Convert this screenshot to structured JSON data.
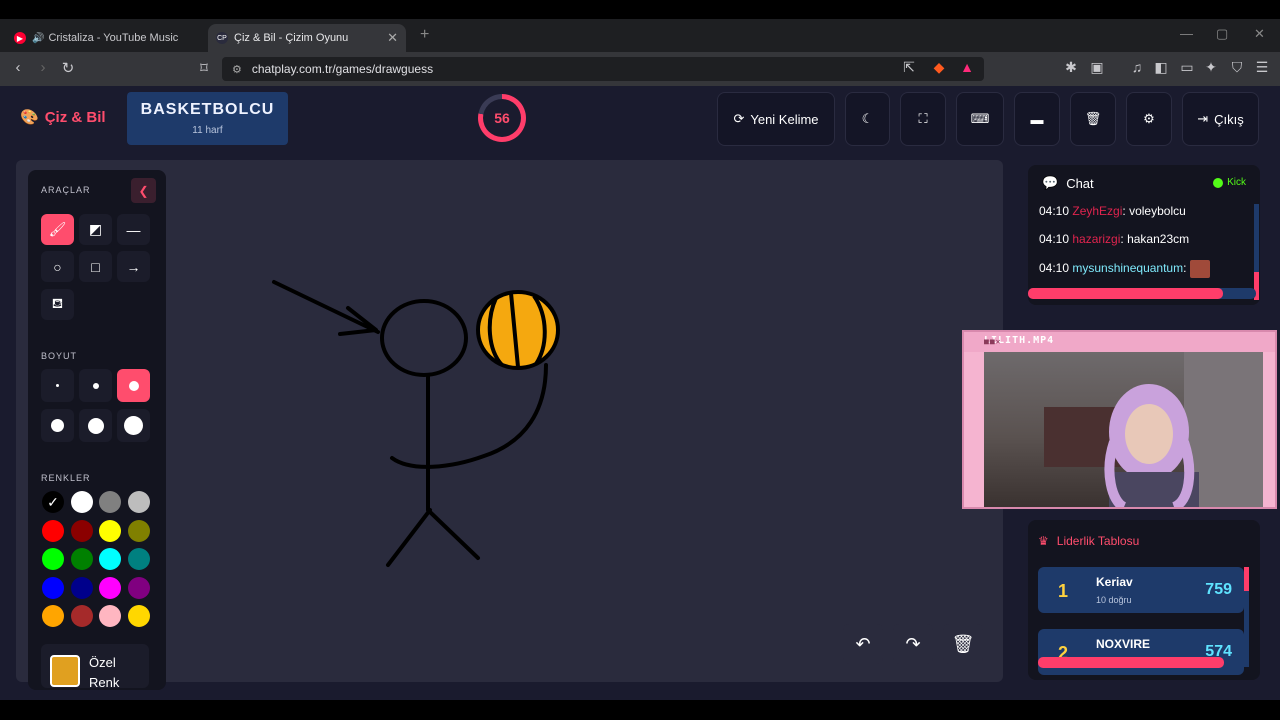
{
  "browser": {
    "tabs": [
      {
        "label": "Cristaliza - YouTube Music"
      },
      {
        "label": "Çiz & Bil - Çizim Oyunu"
      }
    ],
    "url": "chatplay.com.tr/games/drawguess"
  },
  "app": {
    "logo": "Çiz & Bil",
    "word": "BASKETBOLCU",
    "word_hint": "11 harf",
    "timer": "56",
    "timer_fraction": 0.78,
    "buttons": {
      "new_word": "Yeni Kelime",
      "exit": "Çıkış"
    }
  },
  "tools": {
    "section_tools": "ARAÇLAR",
    "section_size": "BOYUT",
    "section_colors": "RENKLER",
    "custom_color_label": "Özel Renk",
    "custom_color": "#e0a020",
    "colors": [
      "#000000",
      "#ffffff",
      "#808080",
      "#bdbdbd",
      "#ff0000",
      "#8b0000",
      "#ffff00",
      "#808000",
      "#00ff00",
      "#008000",
      "#00ffff",
      "#008080",
      "#0000ff",
      "#00008b",
      "#ff00ff",
      "#800080",
      "#ffa500",
      "#a52a2a",
      "#ffb6c1",
      "#ffd700"
    ]
  },
  "chat": {
    "title": "Chat",
    "platform": "Kick",
    "messages": [
      {
        "time": "04:10",
        "user": "ZeyhEzgi",
        "text": "voleybolcu"
      },
      {
        "time": "04:10",
        "user": "hazarizgi",
        "text": "hakan23cm"
      },
      {
        "time": "04:10",
        "user": "mysunshinequantum",
        "text": ""
      }
    ]
  },
  "video": {
    "title": "LILITH.MP4"
  },
  "leaderboard": {
    "title": "Liderlik Tablosu",
    "rows": [
      {
        "rank": "1",
        "name": "Keriav",
        "sub": "10 doğru",
        "points": "759"
      },
      {
        "rank": "2",
        "name": "NOXVIRE",
        "sub": "",
        "points": "574"
      }
    ]
  }
}
